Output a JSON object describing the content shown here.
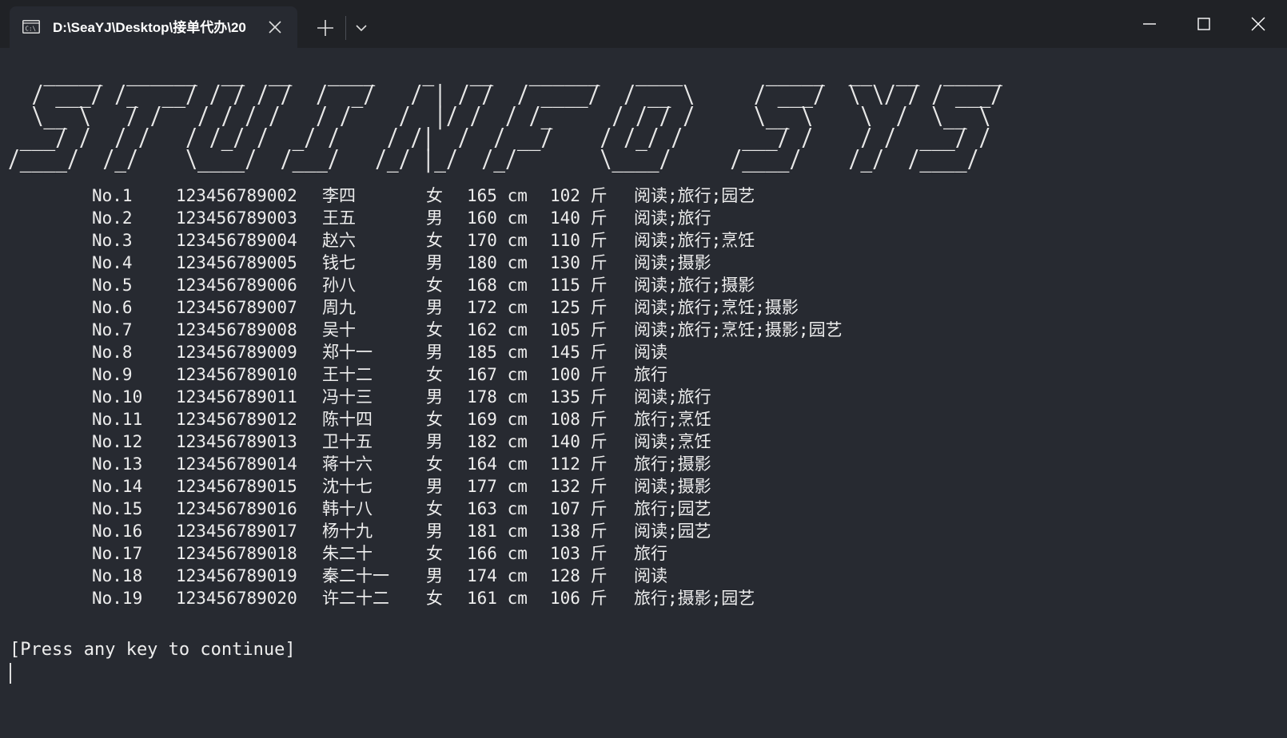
{
  "window": {
    "tab_title": "D:\\SeaYJ\\Desktop\\接单代办\\20",
    "terminal_icon_label": "C:\\",
    "icons": {
      "tab": "terminal-icon",
      "close_tab": "close-icon",
      "new_tab": "plus-icon",
      "dropdown": "chevron-down-icon",
      "minimize": "minimize-icon",
      "maximize": "maximize-icon",
      "close_window": "close-icon"
    }
  },
  "console": {
    "banner": "   _____  ______  __  __   ____    _   __   ______   ____       _____  __  __  _____\n  / ___/ /_  __/ / / / /  /  _/   / | / /  / ____/  / __ \\     / ___/  \\ \\/ / / ___/\n  \\__ \\   / /   / / / /   / /    /  |/ /  / /_     / / / /     \\__ \\    \\  /  \\__ \\\n ___/ /  / /   / /_/ /  _/ /    / /|  /  / __/    / /_/ /     ___/ /    / /  ___/ /\n/____/  /_/    \\____/  /___/   /_/ |_/  /_/       \\____/     /____/    /_/  /____/",
    "rows": [
      {
        "no": "No.1",
        "id": "123456789002",
        "name": "李四",
        "sex": "女",
        "height": "165 cm",
        "weight": "102 斤",
        "hobby": "阅读;旅行;园艺"
      },
      {
        "no": "No.2",
        "id": "123456789003",
        "name": "王五",
        "sex": "男",
        "height": "160 cm",
        "weight": "140 斤",
        "hobby": "阅读;旅行"
      },
      {
        "no": "No.3",
        "id": "123456789004",
        "name": "赵六",
        "sex": "女",
        "height": "170 cm",
        "weight": "110 斤",
        "hobby": "阅读;旅行;烹饪"
      },
      {
        "no": "No.4",
        "id": "123456789005",
        "name": "钱七",
        "sex": "男",
        "height": "180 cm",
        "weight": "130 斤",
        "hobby": "阅读;摄影"
      },
      {
        "no": "No.5",
        "id": "123456789006",
        "name": "孙八",
        "sex": "女",
        "height": "168 cm",
        "weight": "115 斤",
        "hobby": "阅读;旅行;摄影"
      },
      {
        "no": "No.6",
        "id": "123456789007",
        "name": "周九",
        "sex": "男",
        "height": "172 cm",
        "weight": "125 斤",
        "hobby": "阅读;旅行;烹饪;摄影"
      },
      {
        "no": "No.7",
        "id": "123456789008",
        "name": "吴十",
        "sex": "女",
        "height": "162 cm",
        "weight": "105 斤",
        "hobby": "阅读;旅行;烹饪;摄影;园艺"
      },
      {
        "no": "No.8",
        "id": "123456789009",
        "name": "郑十一",
        "sex": "男",
        "height": "185 cm",
        "weight": "145 斤",
        "hobby": "阅读"
      },
      {
        "no": "No.9",
        "id": "123456789010",
        "name": "王十二",
        "sex": "女",
        "height": "167 cm",
        "weight": "100 斤",
        "hobby": "旅行"
      },
      {
        "no": "No.10",
        "id": "123456789011",
        "name": "冯十三",
        "sex": "男",
        "height": "178 cm",
        "weight": "135 斤",
        "hobby": "阅读;旅行"
      },
      {
        "no": "No.11",
        "id": "123456789012",
        "name": "陈十四",
        "sex": "女",
        "height": "169 cm",
        "weight": "108 斤",
        "hobby": "旅行;烹饪"
      },
      {
        "no": "No.12",
        "id": "123456789013",
        "name": "卫十五",
        "sex": "男",
        "height": "182 cm",
        "weight": "140 斤",
        "hobby": "阅读;烹饪"
      },
      {
        "no": "No.13",
        "id": "123456789014",
        "name": "蒋十六",
        "sex": "女",
        "height": "164 cm",
        "weight": "112 斤",
        "hobby": "旅行;摄影"
      },
      {
        "no": "No.14",
        "id": "123456789015",
        "name": "沈十七",
        "sex": "男",
        "height": "177 cm",
        "weight": "132 斤",
        "hobby": "阅读;摄影"
      },
      {
        "no": "No.15",
        "id": "123456789016",
        "name": "韩十八",
        "sex": "女",
        "height": "163 cm",
        "weight": "107 斤",
        "hobby": "旅行;园艺"
      },
      {
        "no": "No.16",
        "id": "123456789017",
        "name": "杨十九",
        "sex": "男",
        "height": "181 cm",
        "weight": "138 斤",
        "hobby": "阅读;园艺"
      },
      {
        "no": "No.17",
        "id": "123456789018",
        "name": "朱二十",
        "sex": "女",
        "height": "166 cm",
        "weight": "103 斤",
        "hobby": "旅行"
      },
      {
        "no": "No.18",
        "id": "123456789019",
        "name": "秦二十一",
        "sex": "男",
        "height": "174 cm",
        "weight": "128 斤",
        "hobby": "阅读"
      },
      {
        "no": "No.19",
        "id": "123456789020",
        "name": "许二十二",
        "sex": "女",
        "height": "161 cm",
        "weight": "106 斤",
        "hobby": "旅行;摄影;园艺"
      }
    ],
    "prompt": "[Press any key to continue]"
  },
  "colors": {
    "background": "#272a31",
    "titlebar": "#202226",
    "text": "#eeeeee"
  }
}
